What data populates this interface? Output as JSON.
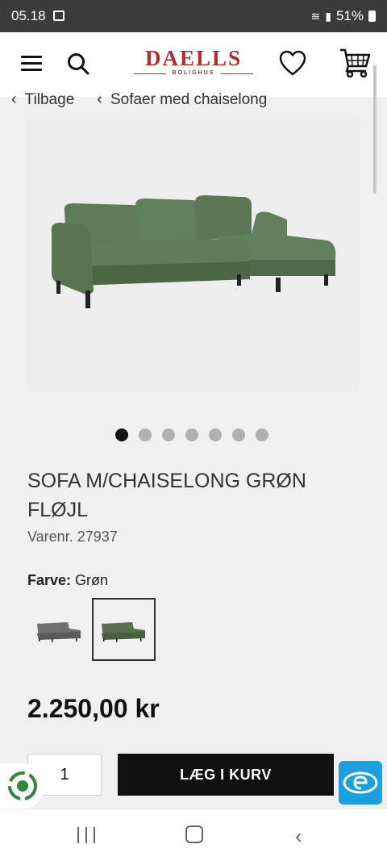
{
  "status_bar": {
    "time": "05.18",
    "battery": "51%"
  },
  "header": {
    "logo_main": "DAELLS",
    "logo_sub": "BOLIGHUS",
    "icons": [
      "menu-icon",
      "search-icon",
      "heart-icon",
      "cart-icon"
    ]
  },
  "breadcrumb": [
    {
      "label": "Tilbage"
    },
    {
      "label": "Sofaer med chaiselong"
    }
  ],
  "gallery": {
    "total": 7,
    "active": 1
  },
  "product": {
    "title": "SOFA M/CHAISELONG GRØN FLØJL",
    "sku": "Varenr. 27937",
    "color_label": "Farve:",
    "color_value": "Grøn",
    "swatches": [
      {
        "name": "grey",
        "color": "#6f6f70"
      },
      {
        "name": "green",
        "color": "#56704f",
        "selected": true
      }
    ],
    "price": "2.250,00 kr"
  },
  "cart": {
    "quantity": "1",
    "add_label": "LÆG I KURV"
  },
  "colors": {
    "brand": "#b52a2a",
    "sofa": "#56704f",
    "button": "#111111",
    "emaerket": "#1aa0de"
  }
}
